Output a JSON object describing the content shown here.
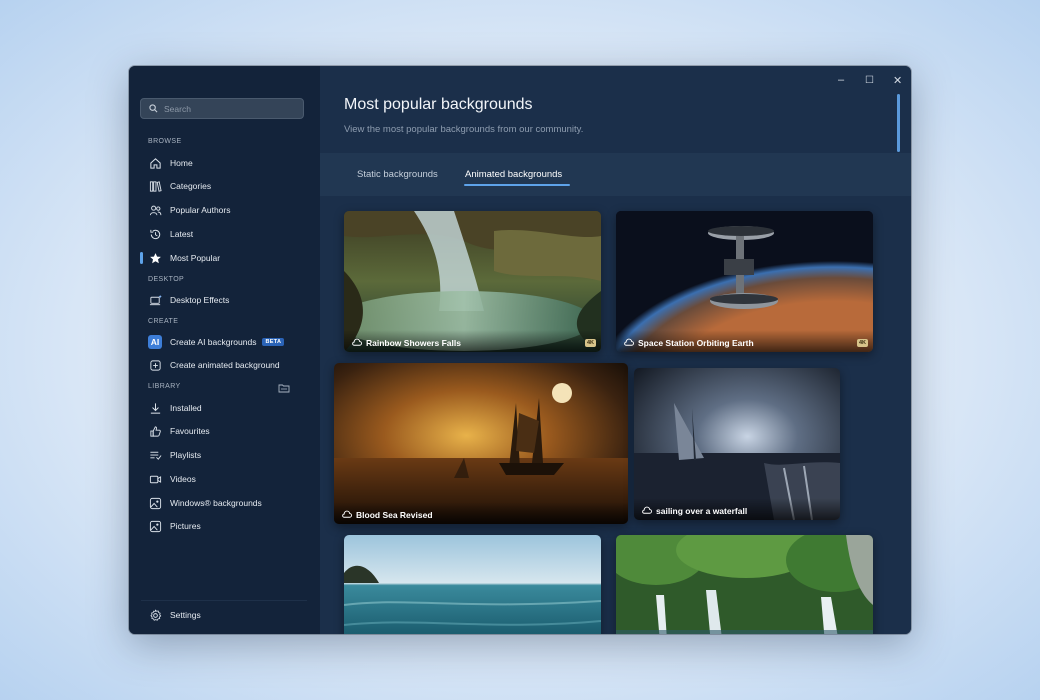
{
  "sidebar": {
    "search_placeholder": "Search",
    "sections": {
      "browse": "BROWSE",
      "desktop": "DESKTOP",
      "create": "CREATE",
      "library": "LIBRARY"
    },
    "browse_items": [
      "Home",
      "Categories",
      "Popular Authors",
      "Latest",
      "Most Popular"
    ],
    "desktop_items": [
      "Desktop Effects"
    ],
    "create_items": [
      "Create AI backgrounds",
      "Create animated background"
    ],
    "beta_badge": "BETA",
    "ai_badge": "AI",
    "library_items": [
      "Installed",
      "Favourites",
      "Playlists",
      "Videos",
      "Windows® backgrounds",
      "Pictures"
    ],
    "settings": "Settings",
    "active_item": "Most Popular"
  },
  "window_controls": {
    "minimize": "–",
    "maximize": "☐",
    "close": "✕"
  },
  "header": {
    "title": "Most popular backgrounds",
    "subtitle": "View the most popular backgrounds from our community."
  },
  "tabs": [
    "Static backgrounds",
    "Animated backgrounds"
  ],
  "active_tab": "Animated backgrounds",
  "cards": [
    {
      "title": "Rainbow Showers Falls",
      "badge": "4K"
    },
    {
      "title": "Space Station Orbiting Earth",
      "badge": "4K"
    },
    {
      "title": "Blood Sea Revised",
      "badge": ""
    },
    {
      "title": "sailing over a waterfall",
      "badge": ""
    },
    {
      "title": "",
      "badge": ""
    },
    {
      "title": "",
      "badge": ""
    }
  ],
  "colors": {
    "accent": "#5ea3ea",
    "sidebar": "#13233a",
    "main": "#1b2f4a",
    "tabbar": "#213752"
  }
}
